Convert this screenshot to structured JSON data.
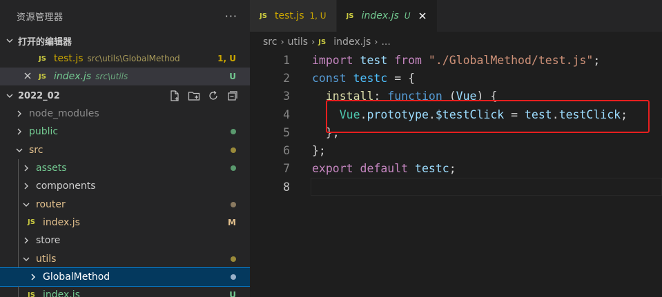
{
  "sidebar": {
    "title": "资源管理器",
    "more_label": "···",
    "open_editors_title": "打开的编辑器",
    "open_editors": [
      {
        "badge": "JS",
        "name": "test.js",
        "path": "src\\utils\\GlobalMethod",
        "status": "1, U"
      },
      {
        "badge": "JS",
        "name": "index.js",
        "path": "src\\utils",
        "status": "U"
      }
    ],
    "project_title": "2022_02",
    "tree": [
      {
        "label": "node_modules"
      },
      {
        "label": "public"
      },
      {
        "label": "src"
      },
      {
        "label": "assets"
      },
      {
        "label": "components"
      },
      {
        "label": "router"
      },
      {
        "label": "index.js",
        "badge": "JS",
        "status": "M"
      },
      {
        "label": "store"
      },
      {
        "label": "utils"
      },
      {
        "label": "GlobalMethod"
      },
      {
        "label": "index.js",
        "badge": "JS",
        "status": "U"
      }
    ]
  },
  "tabs": [
    {
      "badge": "JS",
      "label": "test.js",
      "status": "1, U"
    },
    {
      "badge": "JS",
      "label": "index.js",
      "status": "U"
    }
  ],
  "breadcrumb": {
    "parts": [
      "src",
      "utils"
    ],
    "badge": "JS",
    "file": "index.js",
    "tail": "..."
  },
  "code": {
    "line_numbers": [
      "1",
      "2",
      "3",
      "4",
      "5",
      "6",
      "7",
      "8"
    ],
    "l1": {
      "a": "import",
      "b": "test",
      "c": "from",
      "d": "\"./GlobalMethod/test.js\"",
      "e": ";"
    },
    "l2": {
      "a": "const",
      "b": "testc",
      "c": " = {"
    },
    "l3": {
      "a": "install",
      "b": ": ",
      "c": "function",
      "d": " (",
      "e": "Vue",
      "f": ") {"
    },
    "l4": {
      "a": "Vue",
      "b": ".",
      "c": "prototype",
      "d": ".",
      "e": "$testClick",
      "f": " = ",
      "g": "test",
      "h": ".",
      "i": "testClick",
      "j": ";"
    },
    "l5": {
      "a": "},"
    },
    "l6": {
      "a": "};"
    },
    "l7": {
      "a": "export",
      "b": "default",
      "c": "testc",
      "d": ";"
    }
  },
  "colors": {
    "accent_highlight": "#e81f1f",
    "status_green": "#73c991",
    "status_modified": "#e2c08d"
  }
}
